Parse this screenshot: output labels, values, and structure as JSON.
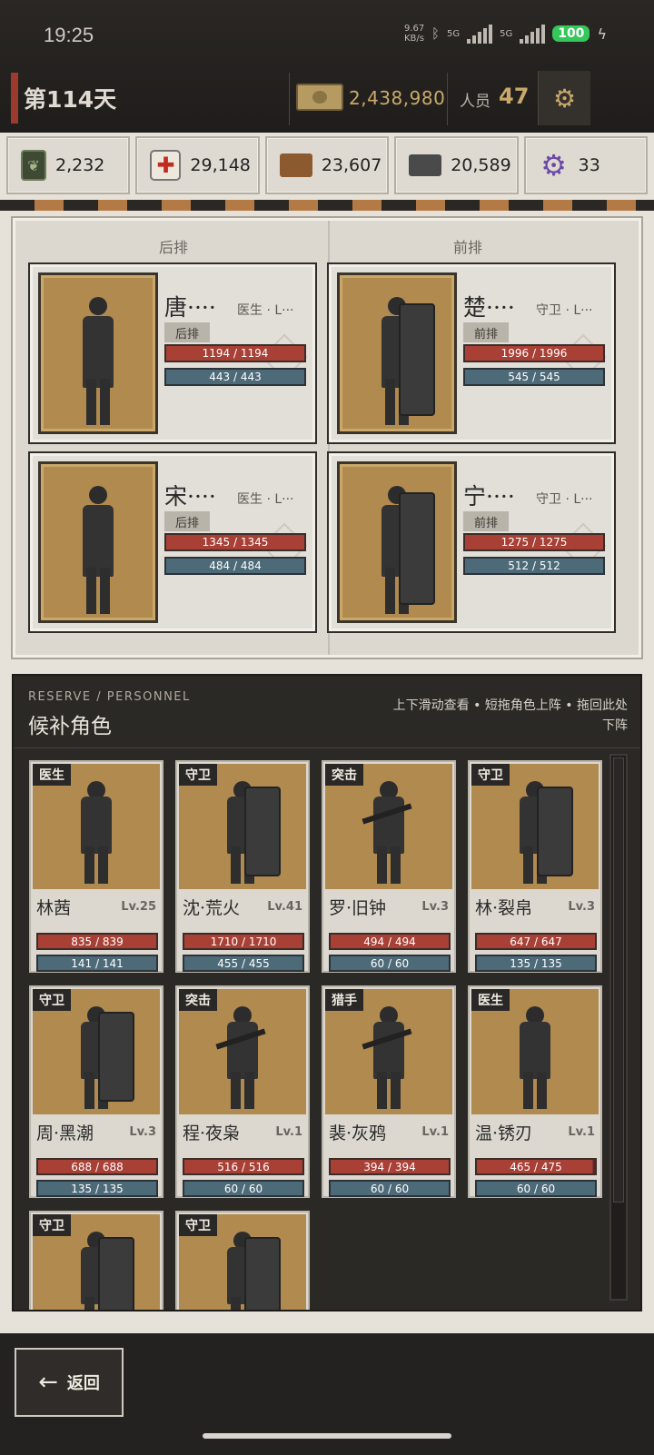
{
  "status_bar": {
    "time": "19:25",
    "net_speed": "9.67 KB/s",
    "signal1": "5G",
    "signal2": "5G",
    "battery": "100"
  },
  "header": {
    "day": "第114天",
    "money": "2,438,980",
    "staff_label": "人员",
    "staff_count": "47",
    "settings_icon": "gear-icon"
  },
  "resources": [
    {
      "icon": "food-can-icon",
      "value": "2,232"
    },
    {
      "icon": "medkit-icon",
      "value": "29,148"
    },
    {
      "icon": "wood-icon",
      "value": "23,607"
    },
    {
      "icon": "metal-icon",
      "value": "20,589"
    },
    {
      "icon": "component-gear-icon",
      "value": "33"
    }
  ],
  "formation": {
    "back_label": "后排",
    "front_label": "前排",
    "cards": [
      {
        "name": "唐····",
        "role": "医生 · L···",
        "tag": "后排",
        "hp": "1194 / 1194",
        "mp": "443 / 443"
      },
      {
        "name": "楚····",
        "role": "守卫 · L···",
        "tag": "前排",
        "hp": "1996 / 1996",
        "mp": "545 / 545"
      },
      {
        "name": "宋····",
        "role": "医生 · L···",
        "tag": "后排",
        "hp": "1345 / 1345",
        "mp": "484 / 484"
      },
      {
        "name": "宁····",
        "role": "守卫 · L···",
        "tag": "前排",
        "hp": "1275 / 1275",
        "mp": "512 / 512"
      }
    ]
  },
  "reserve": {
    "subtitle_en": "RESERVE / PERSONNEL",
    "title": "候补角色",
    "hint": "上下滑动查看 • 短拖角色上阵 • 拖回此处下阵",
    "cards": [
      {
        "tag": "医生",
        "name": "林茜",
        "level": "Lv.25",
        "hp": "835 / 839",
        "mp": "141 / 141"
      },
      {
        "tag": "守卫",
        "name": "沈·荒火",
        "level": "Lv.41",
        "hp": "1710 / 1710",
        "mp": "455 / 455"
      },
      {
        "tag": "突击",
        "name": "罗·旧钟",
        "level": "Lv.3",
        "hp": "494 / 494",
        "mp": "60 / 60"
      },
      {
        "tag": "守卫",
        "name": "林·裂帛",
        "level": "Lv.3",
        "hp": "647 / 647",
        "mp": "135 / 135"
      },
      {
        "tag": "守卫",
        "name": "周·黑潮",
        "level": "Lv.3",
        "hp": "688 / 688",
        "mp": "135 / 135"
      },
      {
        "tag": "突击",
        "name": "程·夜枭",
        "level": "Lv.1",
        "hp": "516 / 516",
        "mp": "60 / 60"
      },
      {
        "tag": "猎手",
        "name": "裴·灰鸦",
        "level": "Lv.1",
        "hp": "394 / 394",
        "mp": "60 / 60"
      },
      {
        "tag": "医生",
        "name": "温·锈刃",
        "level": "Lv.1",
        "hp": "465 / 475",
        "mp": "60 / 60"
      },
      {
        "tag": "守卫"
      },
      {
        "tag": "守卫"
      }
    ]
  },
  "bottom": {
    "back_label": "返回",
    "back_icon": "arrow-left-icon"
  }
}
